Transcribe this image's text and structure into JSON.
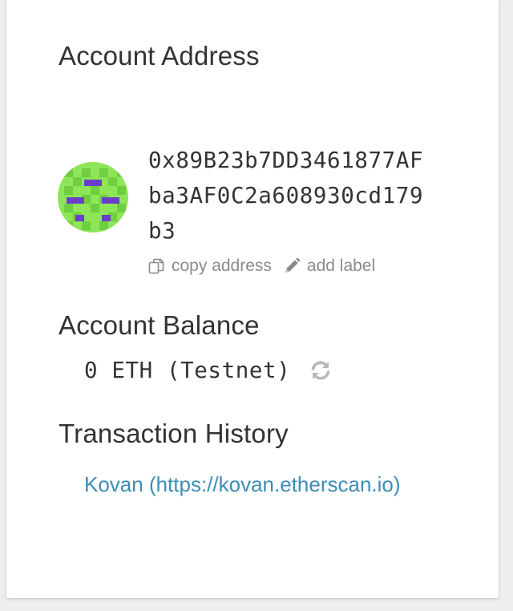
{
  "account": {
    "address_heading": "Account Address",
    "address": "0x89B23b7DD3461877AFba3AF0C2a608930cd179b3",
    "copy_label": "copy address",
    "label_label": "add label",
    "identicon_colors": {
      "primary": "#8ee558",
      "secondary": "#6fce3f",
      "accent": "#6a3ec9"
    }
  },
  "balance": {
    "heading": "Account Balance",
    "value": "0 ETH (Testnet)"
  },
  "history": {
    "heading": "Transaction History",
    "link_text": "Kovan (https://kovan.etherscan.io)"
  },
  "icons": [
    "copy-icon",
    "pencil-icon",
    "refresh-icon"
  ]
}
